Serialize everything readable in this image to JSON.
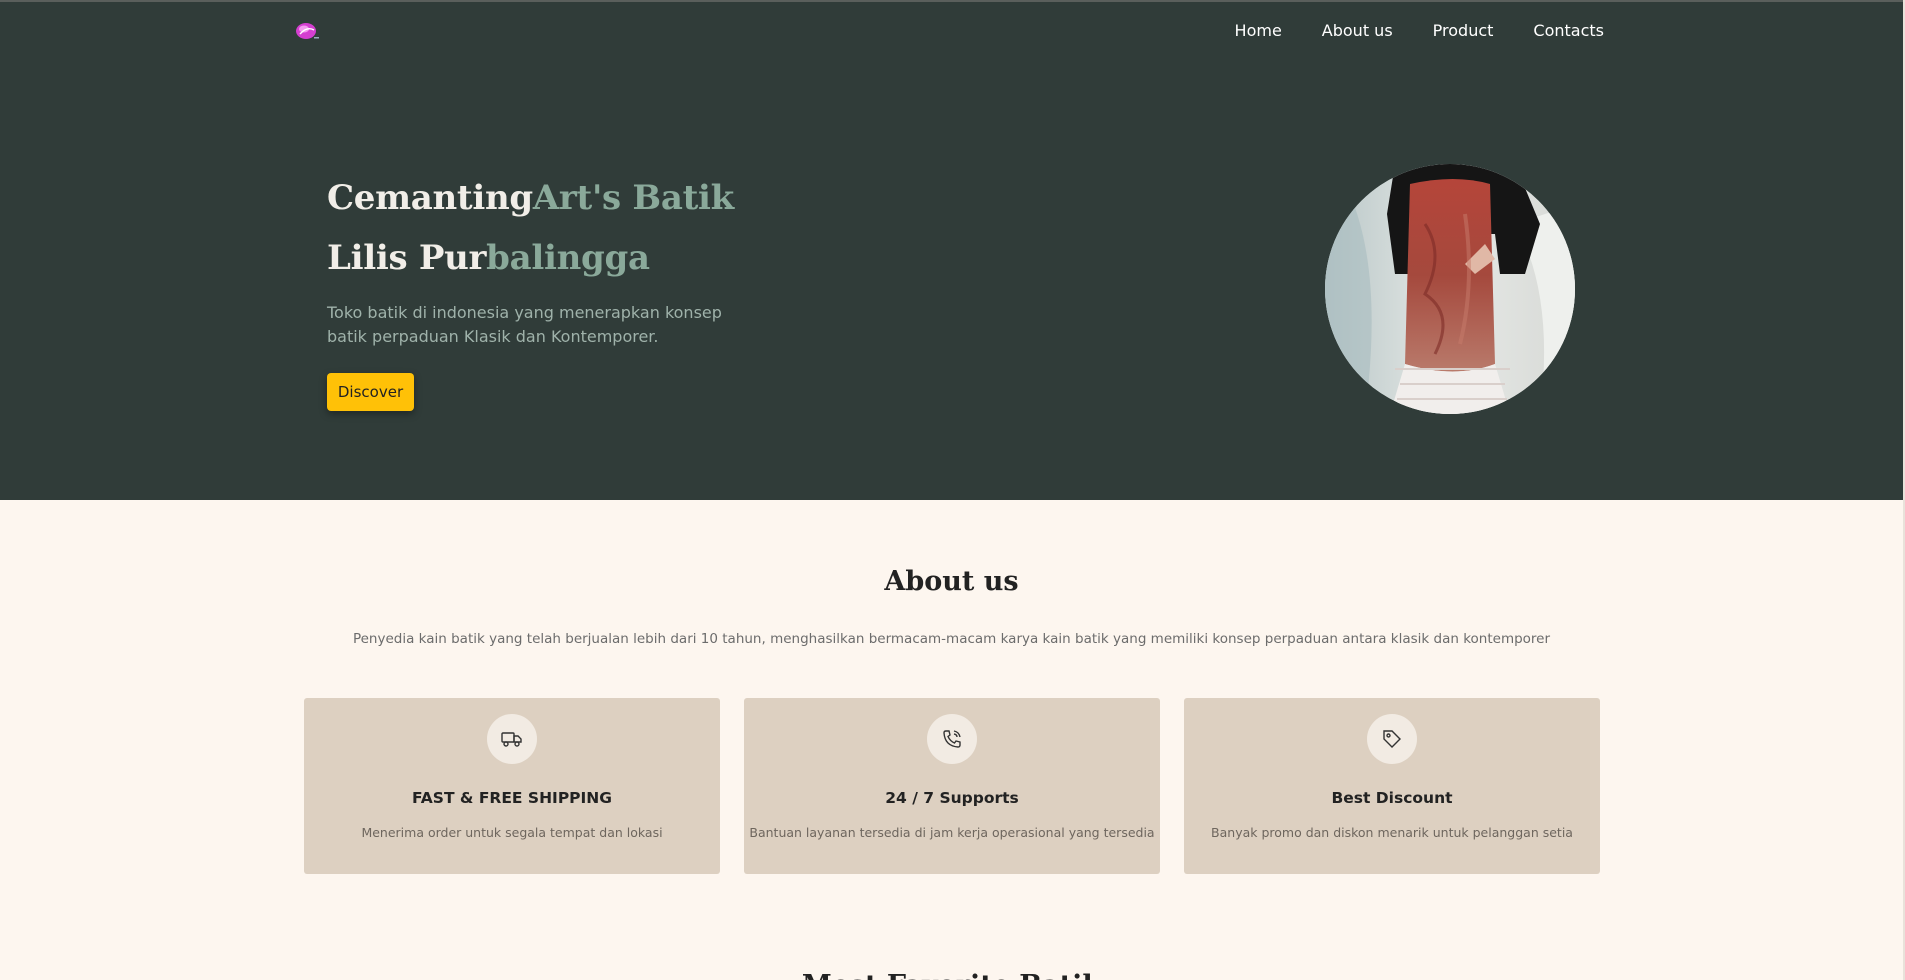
{
  "nav": {
    "logo": "cemantingart-logo",
    "items": [
      "Home",
      "About us",
      "Product",
      "Contacts"
    ]
  },
  "hero": {
    "title_part1": "Cemanting",
    "title_part2": "Art's Batik",
    "title_line2_part1": "Lilis Pur",
    "title_line2_part2": "balingga",
    "description": "Toko batik di indonesia yang menerapkan konsep batik perpaduan Klasik dan Kontemporer.",
    "button_label": "Discover"
  },
  "about": {
    "title": "About us",
    "description": "Penyedia kain batik yang telah berjualan lebih dari 10 tahun, menghasilkan bermacam-macam karya kain batik yang memiliki konsep perpaduan antara klasik dan kontemporer",
    "cards": [
      {
        "icon": "truck-icon",
        "title": "FAST & FREE SHIPPING",
        "description": "Menerima order untuk segala tempat dan lokasi"
      },
      {
        "icon": "phone-icon",
        "title": "24 / 7 Supports",
        "description": "Bantuan layanan tersedia di jam kerja operasional yang tersedia"
      },
      {
        "icon": "tag-icon",
        "title": "Best Discount",
        "description": "Banyak promo dan diskon menarik untuk pelanggan setia"
      }
    ]
  },
  "next_section": {
    "title": "Most Favorite Batik"
  },
  "colors": {
    "hero_bg": "#303c39",
    "accent": "#8aa99a",
    "button": "#ffc107",
    "page_bg": "#fdf6ef",
    "card_bg": "#ddd0c1"
  }
}
